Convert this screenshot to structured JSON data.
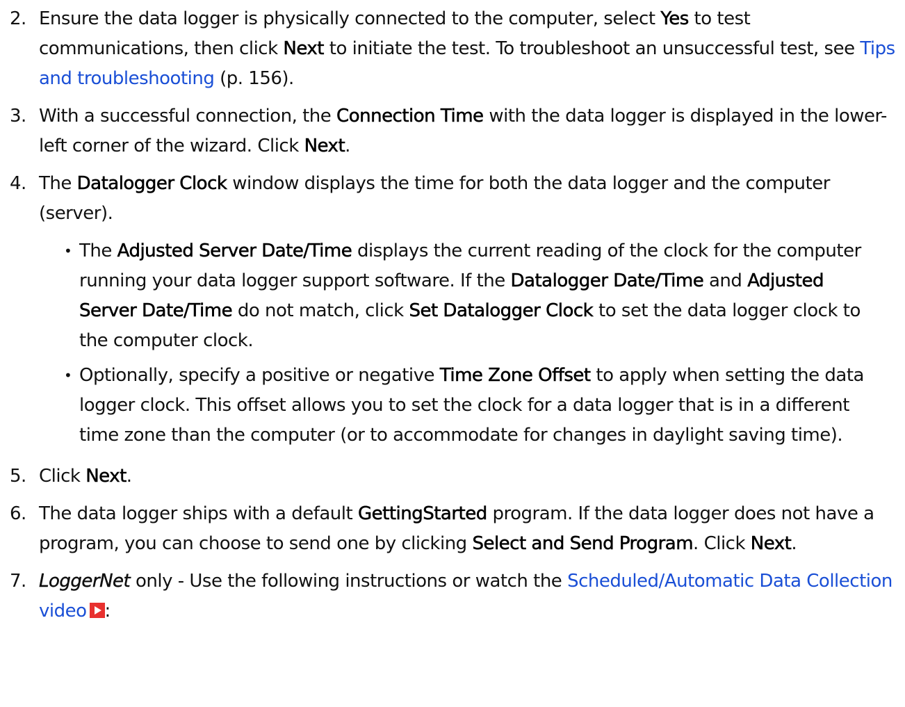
{
  "steps": [
    {
      "num": "2.",
      "t1": "Ensure the data logger is physically connected to the computer, select ",
      "b1": "Yes",
      "t2": " to test communications, then click ",
      "b2": "Next",
      "t3": " to initiate the test. To troubleshoot an unsuccessful test, see ",
      "link": "Tips and troubleshooting",
      "t4": " (p. 156)."
    },
    {
      "num": "3.",
      "t1": "With a successful connection, the ",
      "b1": "Connection Time",
      "t2": " with the data logger is displayed in the lower-left corner of the wizard. Click ",
      "b2": "Next",
      "t3": "."
    },
    {
      "num": "4.",
      "t1": " The ",
      "b1": "Datalogger Clock",
      "t2": " window displays the time for both the data logger and the computer (server).",
      "bullets": [
        {
          "t1": "The ",
          "b1": "Adjusted Server Date/Time",
          "t2": " displays the current reading of the clock for the computer running your data logger support software. If the ",
          "b2": "Datalogger Date/Time",
          "t3": " and ",
          "b3": "Adjusted Server Date/Time",
          "t4": " do not match, click ",
          "b4": "Set Datalogger Clock",
          "t5": " to set the data logger clock to the computer clock."
        },
        {
          "t1": "Optionally, specify a positive or negative ",
          "b1": "Time Zone Offset",
          "t2": " to apply when setting the data logger clock. This offset allows you to set the clock for a data logger that is in a different time zone than the computer (or to accommodate for changes in daylight saving time)."
        }
      ]
    },
    {
      "num": "5.",
      "t1": "Click ",
      "b1": "Next",
      "t2": "."
    },
    {
      "num": "6.",
      "t1": "The data logger ships with a default ",
      "b1": "GettingStarted",
      "t2": " program. If the data logger does not have a program, you can choose to send one by clicking ",
      "b2": "Select and Send Program",
      "t3": ". Click ",
      "b3": "Next",
      "t4": "."
    },
    {
      "num": "7.",
      "i1": "LoggerNet",
      "t1": " only - Use the following instructions or watch the ",
      "link": "Scheduled/Automatic Data Collection video",
      "icon": "play-video-icon",
      "t2": ":"
    }
  ]
}
